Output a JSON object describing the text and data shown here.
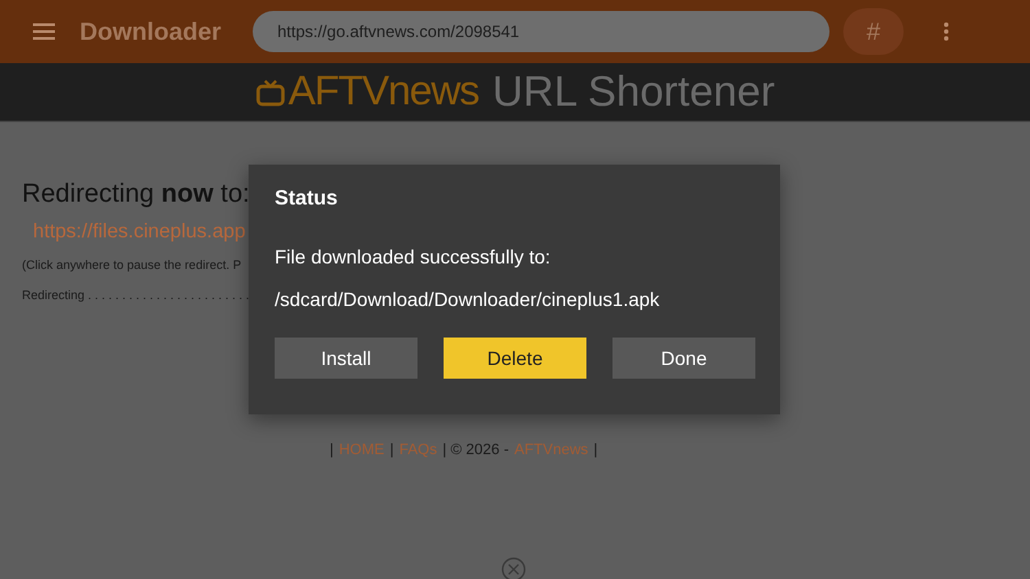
{
  "app_bar": {
    "title": "Downloader",
    "url": "https://go.aftvnews.com/2098541",
    "hash_button": "#"
  },
  "banner": {
    "brand": "AFTVnews",
    "title": "URL Shortener"
  },
  "page": {
    "heading": "Redirecting **now** to:",
    "link": "https://files.cineplus.app",
    "note": "(Click anywhere to pause the redirect. P",
    "progress_label": "Redirecting . . . . . . . . . . . . . . . . . . . . . . . ."
  },
  "footer": [
    {
      "kind": "sep",
      "text": "|"
    },
    {
      "kind": "link",
      "text": "HOME"
    },
    {
      "kind": "sep",
      "text": "|"
    },
    {
      "kind": "link",
      "text": "FAQs"
    },
    {
      "kind": "sep",
      "text": "| © 2026 -"
    },
    {
      "kind": "link",
      "text": "AFTVnews"
    },
    {
      "kind": "sep",
      "text": "|"
    }
  ],
  "dialog": {
    "title": "Status",
    "message": "File downloaded successfully to:",
    "path": "/sdcard/Download/Downloader/cineplus1.apk",
    "buttons": [
      {
        "label": "Install",
        "selected": false
      },
      {
        "label": "Delete",
        "selected": true
      },
      {
        "label": "Done",
        "selected": false
      }
    ]
  }
}
